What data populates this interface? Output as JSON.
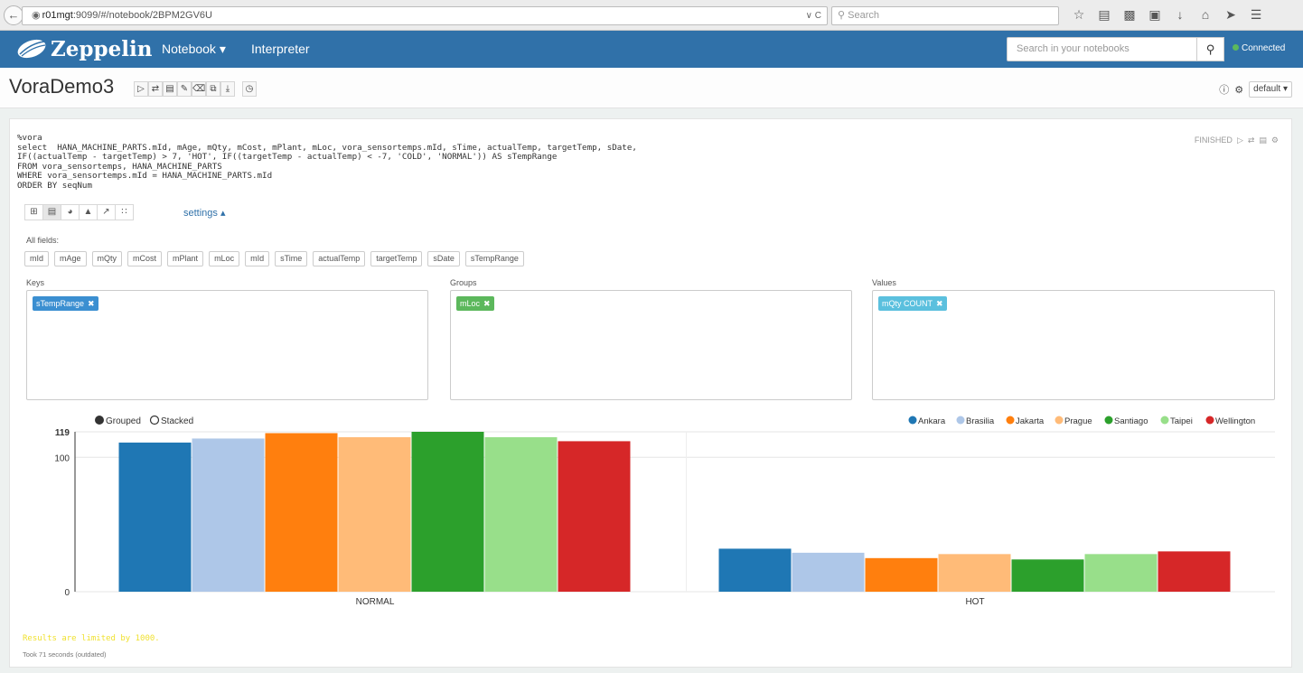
{
  "browser": {
    "url_host": "r01mgt",
    "url_rest": ":9099/#/notebook/2BPM2GV6U",
    "search_placeholder": "Search"
  },
  "header": {
    "brand": "Zeppelin",
    "nav_notebook": "Notebook",
    "nav_interpreter": "Interpreter",
    "search_placeholder": "Search in your notebooks",
    "status": "Connected",
    "colors": {
      "header_bg": "#3071a9",
      "connected": "#5cb85c"
    }
  },
  "notebook": {
    "title": "VoraDemo3",
    "interpreter_dropdown": "default"
  },
  "paragraph": {
    "code_lines": [
      "%vora",
      "select  HANA_MACHINE_PARTS.mId, mAge, mQty, mCost, mPlant, mLoc, vora_sensortemps.mId, sTime, actualTemp, targetTemp, sDate,",
      "IF((actualTemp - targetTemp) > 7, 'HOT', IF((targetTemp - actualTemp) < -7, 'COLD', 'NORMAL')) AS sTempRange",
      "FROM vora_sensortemps, HANA_MACHINE_PARTS",
      "WHERE vora_sensortemps.mId = HANA_MACHINE_PARTS.mId",
      "ORDER BY seqNum"
    ],
    "status": "FINISHED",
    "settings_label": "settings",
    "all_fields_label": "All fields:",
    "fields": [
      "mId",
      "mAge",
      "mQty",
      "mCost",
      "mPlant",
      "mLoc",
      "mId",
      "sTime",
      "actualTemp",
      "targetTemp",
      "sDate",
      "sTempRange"
    ],
    "keys_label": "Keys",
    "groups_label": "Groups",
    "values_label": "Values",
    "key_chip": "sTempRange",
    "group_chip": "mLoc",
    "value_chip": "mQty  COUNT",
    "grouped_label": "Grouped",
    "stacked_label": "Stacked",
    "limit_message": "Results are limited by 1000.",
    "took_message": "Took 71 seconds (outdated)"
  },
  "chart_data": {
    "type": "bar",
    "mode": "grouped",
    "categories": [
      "NORMAL",
      "HOT"
    ],
    "ylim": [
      0,
      119
    ],
    "y_ticks": [
      0,
      100,
      119
    ],
    "grid": true,
    "legend_position": "top-right",
    "series": [
      {
        "name": "Ankara",
        "color": "#1f77b4",
        "values": [
          111,
          32
        ]
      },
      {
        "name": "Brasilia",
        "color": "#aec7e8",
        "values": [
          114,
          29
        ]
      },
      {
        "name": "Jakarta",
        "color": "#ff7f0e",
        "values": [
          118,
          25
        ]
      },
      {
        "name": "Prague",
        "color": "#ffbb78",
        "values": [
          115,
          28
        ]
      },
      {
        "name": "Santiago",
        "color": "#2ca02c",
        "values": [
          119,
          24
        ]
      },
      {
        "name": "Taipei",
        "color": "#98df8a",
        "values": [
          115,
          28
        ]
      },
      {
        "name": "Wellington",
        "color": "#d62728",
        "values": [
          112,
          30
        ]
      }
    ]
  }
}
